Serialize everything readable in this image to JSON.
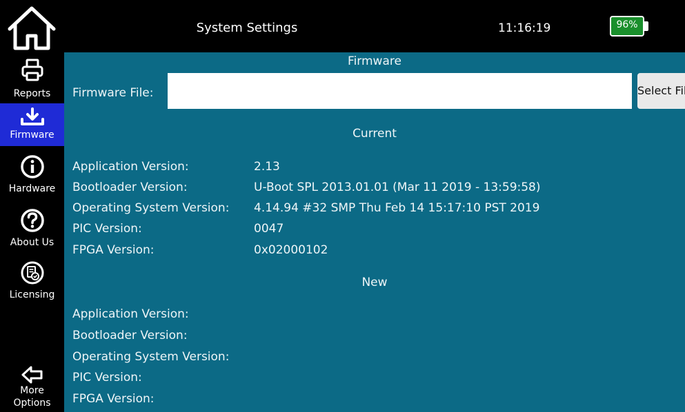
{
  "header": {
    "title": "System Settings",
    "time": "11:16:19",
    "battery": "96%",
    "battery_color": "#1a8f2c"
  },
  "sidebar": {
    "items": [
      {
        "label": "Reports",
        "icon": "printer-icon"
      },
      {
        "label": "Firmware",
        "icon": "download-icon",
        "active": true
      },
      {
        "label": "Hardware",
        "icon": "info-icon"
      },
      {
        "label": "About Us",
        "icon": "question-icon"
      },
      {
        "label": "Licensing",
        "icon": "license-icon"
      }
    ],
    "more_options_line1": "More",
    "more_options_line2": "Options"
  },
  "firmware": {
    "section_title": "Firmware",
    "file_label": "Firmware File:",
    "file_value": "",
    "select_button": "Select File"
  },
  "current": {
    "section_title": "Current",
    "rows": [
      {
        "label": "Application Version:",
        "value": "2.13"
      },
      {
        "label": "Bootloader Version:",
        "value": "U-Boot SPL 2013.01.01 (Mar 11 2019 - 13:59:58)"
      },
      {
        "label": "Operating System Version:",
        "value": "4.14.94 #32 SMP Thu Feb 14 15:17:10 PST 2019"
      },
      {
        "label": "PIC Version:",
        "value": "0047"
      },
      {
        "label": "FPGA Version:",
        "value": "0x02000102"
      }
    ]
  },
  "new": {
    "section_title": "New",
    "rows": [
      {
        "label": "Application Version:",
        "value": ""
      },
      {
        "label": "Bootloader Version:",
        "value": ""
      },
      {
        "label": "Operating System Version:",
        "value": ""
      },
      {
        "label": "PIC Version:",
        "value": ""
      },
      {
        "label": "FPGA Version:",
        "value": ""
      }
    ]
  },
  "colors": {
    "content_bg": "#0c6a86",
    "active_tab": "#1f2bd6"
  }
}
